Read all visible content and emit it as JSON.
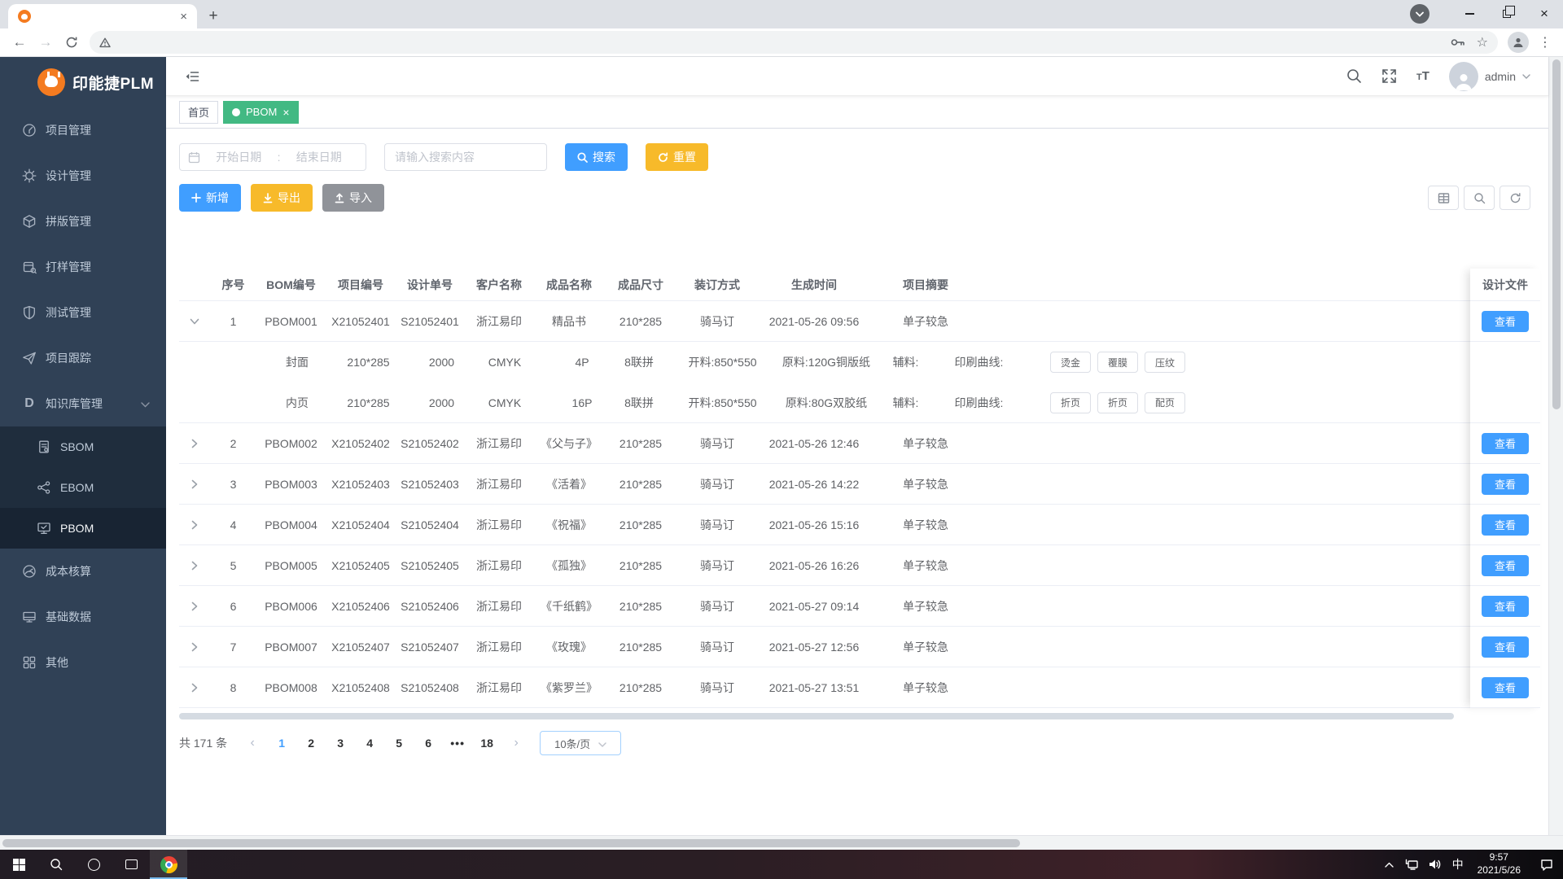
{
  "colors": {
    "primary": "#409eff",
    "warning": "#f7ba2a",
    "info_gray": "#909399",
    "active_tag_green": "#42b983",
    "sidebar_bg": "#304156",
    "submenu_bg": "#1f2d3d"
  },
  "browser": {
    "tab": {
      "close": "×",
      "new_tab": "+"
    },
    "window": {
      "close": "×"
    },
    "toolbar": {
      "back": "←",
      "forward": "→",
      "star": "☆",
      "menu": "⋮"
    }
  },
  "sidebar": {
    "logo_text": "印能捷PLM",
    "items": [
      {
        "key": "project",
        "icon": "gauge-icon",
        "label": "项目管理"
      },
      {
        "key": "design",
        "icon": "gear-icon",
        "label": "设计管理"
      },
      {
        "key": "impose",
        "icon": "cube-icon",
        "label": "拼版管理"
      },
      {
        "key": "proof",
        "icon": "sample-box-icon",
        "label": "打样管理"
      },
      {
        "key": "test",
        "icon": "shield-icon",
        "label": "测试管理"
      },
      {
        "key": "tracking",
        "icon": "paper-plane-icon",
        "label": "项目跟踪"
      },
      {
        "key": "knowledge",
        "icon": "letter-d-icon",
        "label": "知识库管理",
        "expanded": true,
        "children": [
          {
            "key": "sbom",
            "icon": "document-icon",
            "label": "SBOM"
          },
          {
            "key": "ebom",
            "icon": "share-icon",
            "label": "EBOM"
          },
          {
            "key": "pbom",
            "icon": "monitor-check-icon",
            "label": "PBOM",
            "active": true
          }
        ]
      },
      {
        "key": "cost",
        "icon": "meter-icon",
        "label": "成本核算"
      },
      {
        "key": "basedata",
        "icon": "display-icon",
        "label": "基础数据"
      },
      {
        "key": "other",
        "icon": "grid-icon",
        "label": "其他"
      }
    ]
  },
  "header": {
    "username": "admin"
  },
  "tags": [
    {
      "label": "首页",
      "active": false,
      "closable": false
    },
    {
      "label": "PBOM",
      "active": true,
      "closable": true
    }
  ],
  "filters": {
    "date_start": "开始日期",
    "date_sep": ":",
    "date_end": "结束日期",
    "search_placeholder": "请输入搜索内容",
    "search_btn": "搜索",
    "reset_btn": "重置"
  },
  "actions": {
    "add": "新增",
    "export": "导出",
    "import": "导入"
  },
  "table": {
    "columns": [
      "序号",
      "BOM编号",
      "项目编号",
      "设计单号",
      "客户名称",
      "成品名称",
      "成品尺寸",
      "装订方式",
      "生成时间",
      "项目摘要"
    ],
    "fixed_column": "设计文件",
    "view_btn": "查看",
    "rows": [
      {
        "seq": "1",
        "bom": "PBOM001",
        "project": "X21052401",
        "design": "S21052401",
        "customer": "浙江易印",
        "product": "精品书",
        "size": "210*285",
        "binding": "骑马订",
        "time": "2021-05-26 09:56",
        "summary": "单子较急",
        "expanded": true,
        "details": [
          {
            "part": "封面",
            "size": "210*285",
            "qty": "2000",
            "color": "CMYK",
            "pages": "4P",
            "impose": "8联拼",
            "cut": "开料:850*550",
            "material": "原料:120G铜版纸",
            "aux": "辅料:",
            "curve": "印刷曲线:",
            "tags": [
              "烫金",
              "覆膜",
              "压纹"
            ]
          },
          {
            "part": "内页",
            "size": "210*285",
            "qty": "2000",
            "color": "CMYK",
            "pages": "16P",
            "impose": "8联拼",
            "cut": "开料:850*550",
            "material": "原料:80G双胶纸",
            "aux": "辅料:",
            "curve": "印刷曲线:",
            "tags": [
              "折页",
              "折页",
              "配页"
            ]
          }
        ]
      },
      {
        "seq": "2",
        "bom": "PBOM002",
        "project": "X21052402",
        "design": "S21052402",
        "customer": "浙江易印",
        "product": "《父与子》",
        "size": "210*285",
        "binding": "骑马订",
        "time": "2021-05-26 12:46",
        "summary": "单子较急",
        "expanded": false,
        "details": []
      },
      {
        "seq": "3",
        "bom": "PBOM003",
        "project": "X21052403",
        "design": "S21052403",
        "customer": "浙江易印",
        "product": "《活着》",
        "size": "210*285",
        "binding": "骑马订",
        "time": "2021-05-26 14:22",
        "summary": "单子较急",
        "expanded": false,
        "details": []
      },
      {
        "seq": "4",
        "bom": "PBOM004",
        "project": "X21052404",
        "design": "S21052404",
        "customer": "浙江易印",
        "product": "《祝福》",
        "size": "210*285",
        "binding": "骑马订",
        "time": "2021-05-26 15:16",
        "summary": "单子较急",
        "expanded": false,
        "details": []
      },
      {
        "seq": "5",
        "bom": "PBOM005",
        "project": "X21052405",
        "design": "S21052405",
        "customer": "浙江易印",
        "product": "《孤独》",
        "size": "210*285",
        "binding": "骑马订",
        "time": "2021-05-26 16:26",
        "summary": "单子较急",
        "expanded": false,
        "details": []
      },
      {
        "seq": "6",
        "bom": "PBOM006",
        "project": "X21052406",
        "design": "S21052406",
        "customer": "浙江易印",
        "product": "《千纸鹤》",
        "size": "210*285",
        "binding": "骑马订",
        "time": "2021-05-27 09:14",
        "summary": "单子较急",
        "expanded": false,
        "details": []
      },
      {
        "seq": "7",
        "bom": "PBOM007",
        "project": "X21052407",
        "design": "S21052407",
        "customer": "浙江易印",
        "product": "《玫瑰》",
        "size": "210*285",
        "binding": "骑马订",
        "time": "2021-05-27 12:56",
        "summary": "单子较急",
        "expanded": false,
        "details": []
      },
      {
        "seq": "8",
        "bom": "PBOM008",
        "project": "X21052408",
        "design": "S21052408",
        "customer": "浙江易印",
        "product": "《紫罗兰》",
        "size": "210*285",
        "binding": "骑马订",
        "time": "2021-05-27 13:51",
        "summary": "单子较急",
        "expanded": false,
        "details": []
      }
    ]
  },
  "pagination": {
    "total": "共 171 条",
    "prev": "‹",
    "next": "›",
    "pages": [
      "1",
      "2",
      "3",
      "4",
      "5",
      "6",
      "•••",
      "18"
    ],
    "active": "1",
    "page_size": "10条/页"
  },
  "taskbar": {
    "ime": "中",
    "time": "9:57",
    "date": "2021/5/26"
  }
}
